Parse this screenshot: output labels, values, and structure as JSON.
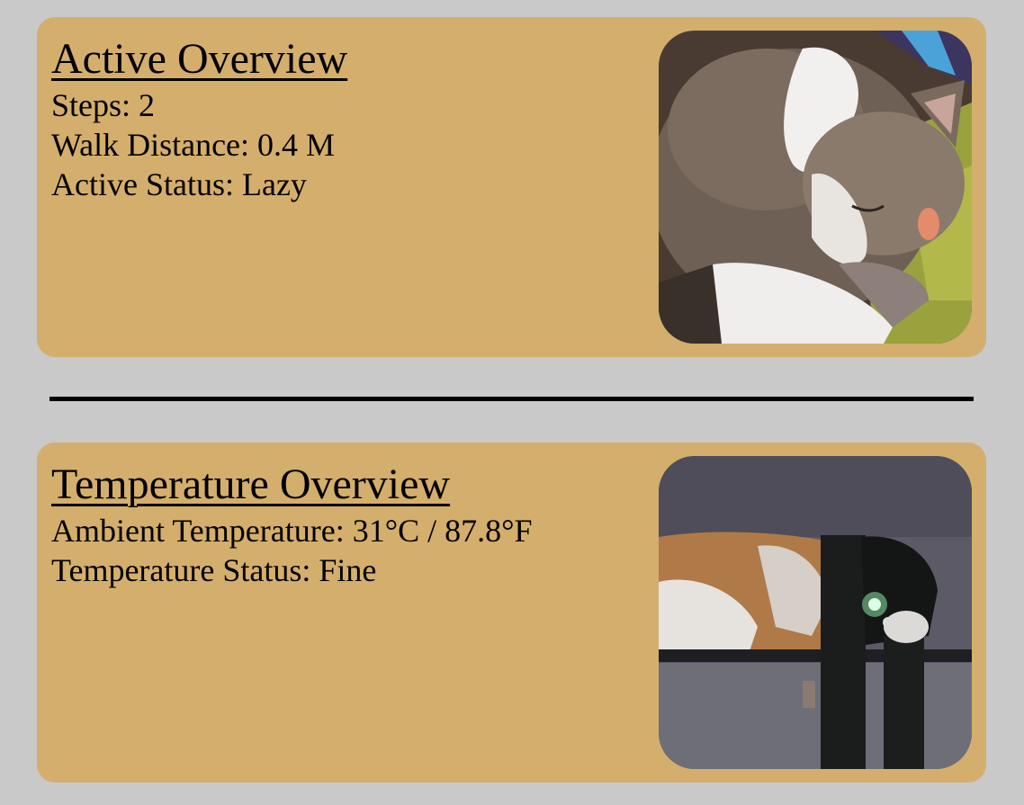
{
  "active": {
    "title": "Active Overview",
    "steps": "Steps: 2",
    "walk_distance": "Walk Distance: 0.4 M",
    "active_status": "Active Status: Lazy",
    "image": "sleeping-cat-photo"
  },
  "temperature": {
    "title": "Temperature Overview",
    "ambient": "Ambient Temperature: 31°C / 87.8°F",
    "status": "Temperature Status: Fine",
    "image": "cat-on-shelf-photo"
  },
  "colors": {
    "background": "#c9c9c9",
    "card": "#d4ae6c",
    "divider": "#000000"
  }
}
